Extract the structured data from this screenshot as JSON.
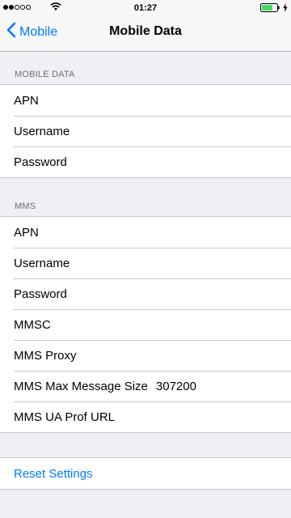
{
  "status_bar": {
    "time": "01:27",
    "signal_dots_filled": 2,
    "signal_dots_total": 5,
    "icons": [
      "signal-icon",
      "wifi-icon",
      "battery-icon",
      "charging-bolt-icon"
    ]
  },
  "nav": {
    "back_label": "Mobile",
    "title": "Mobile Data",
    "accent_color": "#007aff"
  },
  "mobile_data_section": {
    "header": "MOBILE DATA",
    "rows": [
      {
        "label": "APN",
        "value": ""
      },
      {
        "label": "Username",
        "value": ""
      },
      {
        "label": "Password",
        "value": ""
      }
    ]
  },
  "mms_section": {
    "header": "MMS",
    "rows": [
      {
        "label": "APN",
        "value": ""
      },
      {
        "label": "Username",
        "value": ""
      },
      {
        "label": "Password",
        "value": ""
      },
      {
        "label": "MMSC",
        "value": ""
      },
      {
        "label": "MMS Proxy",
        "value": ""
      },
      {
        "label": "MMS Max Message Size",
        "value": "307200"
      },
      {
        "label": "MMS UA Prof URL",
        "value": ""
      }
    ]
  },
  "reset": {
    "label": "Reset Settings"
  }
}
